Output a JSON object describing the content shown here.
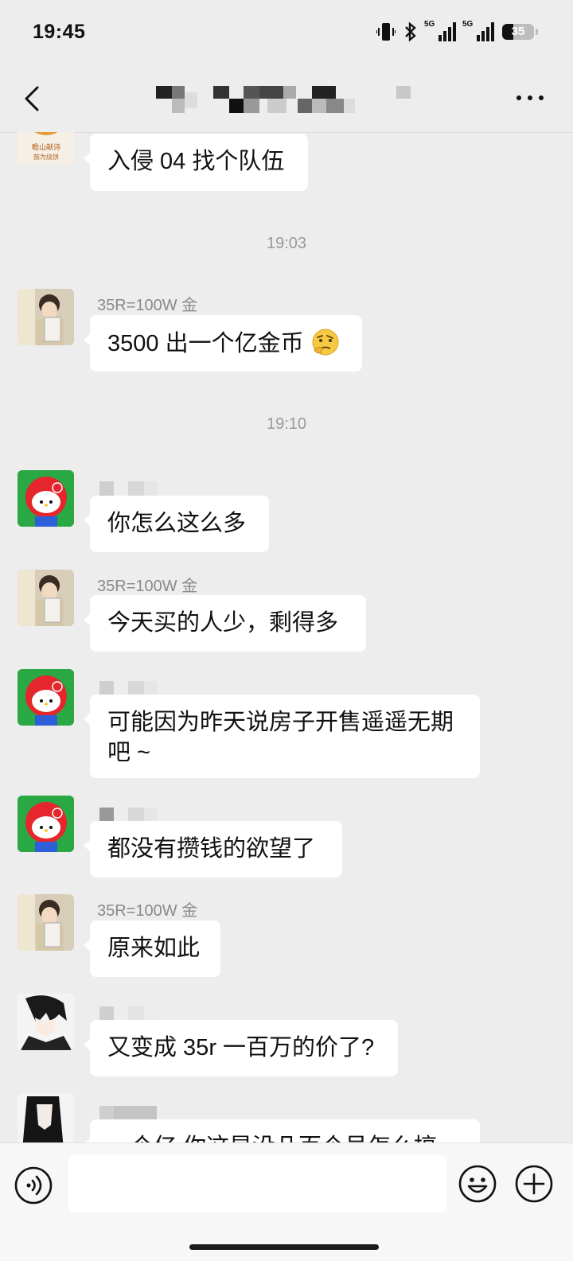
{
  "status_bar": {
    "time": "19:45",
    "net1": "5G",
    "net2": "5G",
    "battery": "35"
  },
  "header": {
    "back_icon": "chevron-left-icon",
    "more_icon": "more-dots-icon"
  },
  "messages": [
    {
      "text": "入侵 04 找个队伍"
    },
    {
      "timestamp": "19:03"
    },
    {
      "sender": "35R=100W 金",
      "text": "3500 出一个亿金币"
    },
    {
      "timestamp": "19:10"
    },
    {
      "text": "你怎么这么多"
    },
    {
      "sender": "35R=100W 金",
      "text": "今天买的人少，剩得多"
    },
    {
      "text_line1": "可能因为昨天说房子开售遥遥无期",
      "text_line2": "吧 ~"
    },
    {
      "text": "都没有攒钱的欲望了"
    },
    {
      "sender": "35R=100W 金",
      "text": "原来如此"
    },
    {
      "text": "又变成 35r 一百万的价了?"
    },
    {
      "text": "一个亿 你这是没几百个号怎么搞"
    }
  ],
  "input_bar": {
    "voice_icon": "voice-icon",
    "emoji_icon": "emoji-icon",
    "plus_icon": "plus-icon"
  },
  "colors": {
    "background": "#ededed",
    "bubble": "#ffffff",
    "meta_text": "#8a8a8a"
  }
}
